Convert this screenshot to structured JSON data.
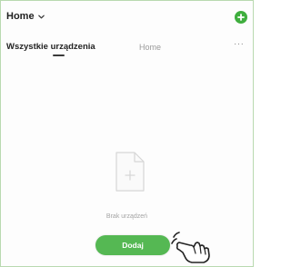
{
  "header": {
    "home_label": "Home"
  },
  "tabs": {
    "all_devices": "Wszystkie urządzenia",
    "home": "Home",
    "more": "···"
  },
  "empty_state": {
    "text": "Brak urządzeń",
    "icon": "blank-document-icon"
  },
  "actions": {
    "add_label": "Dodaj"
  },
  "colors": {
    "accent_green": "#3fae3e",
    "button_green": "#55b853",
    "border_green": "#b9d9b0"
  },
  "icons": {
    "add": "plus-circle-icon",
    "dropdown": "chevron-down-icon",
    "cursor": "hand-pointer-icon"
  }
}
